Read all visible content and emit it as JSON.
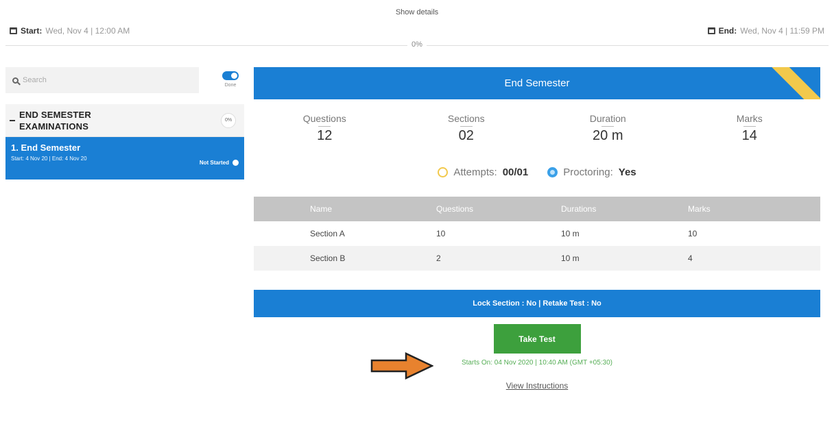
{
  "header": {
    "show_details": "Show details",
    "start_label": "Start:",
    "start_value": "Wed, Nov 4 | 12:00 AM",
    "end_label": "End:",
    "end_value": "Wed, Nov 4 | 11:59 PM",
    "progress": "0%"
  },
  "sidebar": {
    "search_placeholder": "Search",
    "toggle_label": "Done",
    "group_title_line1": "END SEMESTER",
    "group_title_line2": "EXAMINATIONS",
    "group_percent": "0%",
    "items": [
      {
        "title": "1. End Semester",
        "subtitle": "Start: 4 Nov 20 | End: 4 Nov 20",
        "status": "Not Started"
      }
    ]
  },
  "exam": {
    "title": "End Semester",
    "stats": [
      {
        "label": "Questions",
        "value": "12"
      },
      {
        "label": "Sections",
        "value": "02"
      },
      {
        "label": "Duration",
        "value": "20 m"
      },
      {
        "label": "Marks",
        "value": "14"
      }
    ],
    "attempts_label": "Attempts:",
    "attempts_value": "00/01",
    "proctoring_label": "Proctoring:",
    "proctoring_value": "Yes"
  },
  "sections_table": {
    "headers": [
      "Name",
      "Questions",
      "Durations",
      "Marks"
    ],
    "rows": [
      [
        "Section A",
        "10",
        "10 m",
        "10"
      ],
      [
        "Section B",
        "2",
        "10 m",
        "4"
      ]
    ]
  },
  "footer": {
    "lock_info": "Lock Section : No | Retake Test : No",
    "take_test": "Take Test",
    "starts_on": "Starts On: 04 Nov 2020 | 10:40 AM (GMT +05:30)",
    "view_instructions": "View Instructions"
  },
  "colors": {
    "primary": "#1a7fd4",
    "success": "#3da03d",
    "ribbon": "#f2c94c",
    "arrow": "#e8822e"
  }
}
